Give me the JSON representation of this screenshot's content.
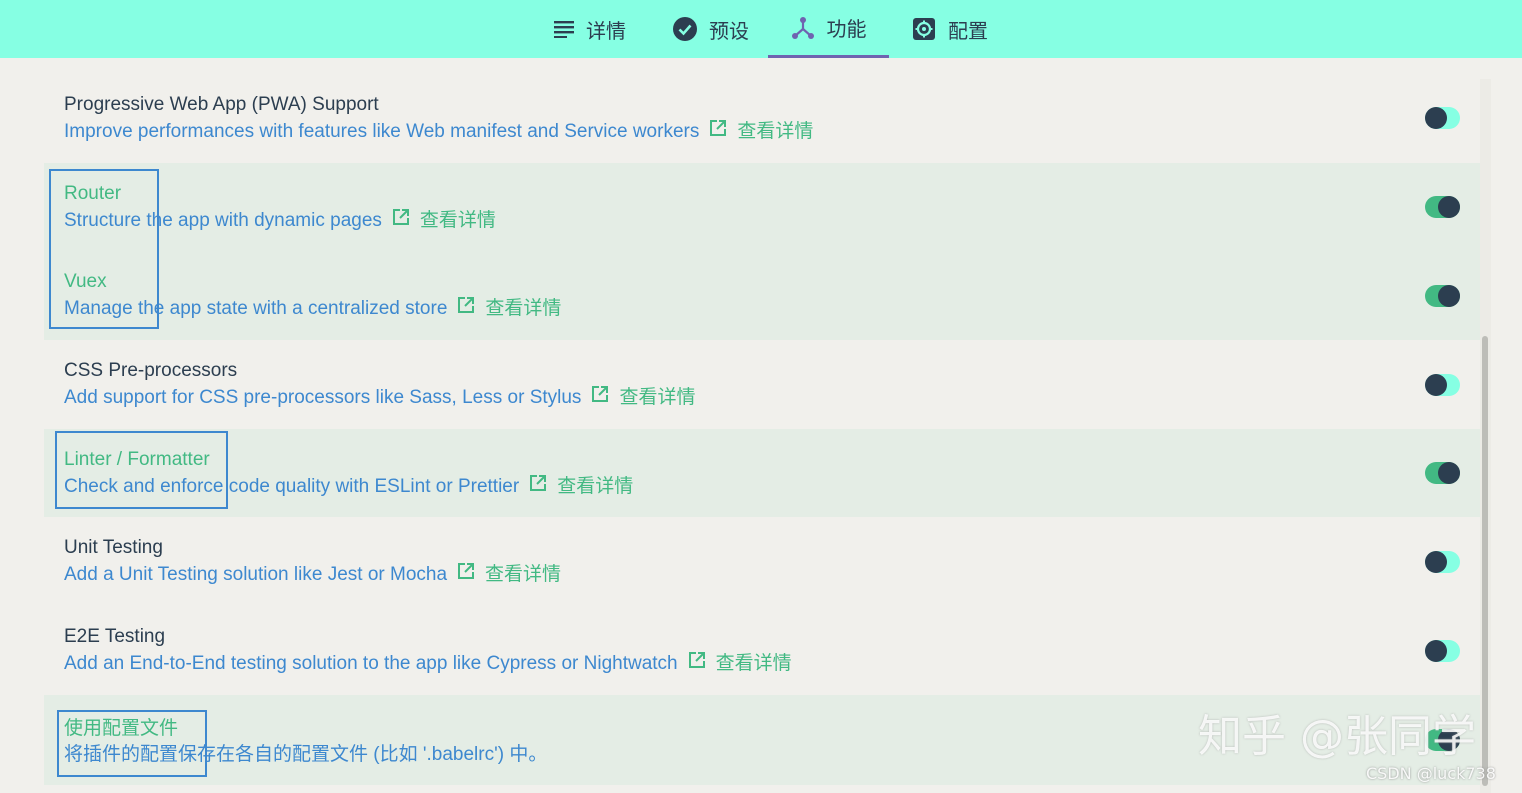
{
  "tabs": [
    {
      "label": "详情",
      "icon": "list-icon"
    },
    {
      "label": "预设",
      "icon": "check-circle-icon"
    },
    {
      "label": "功能",
      "icon": "branch-icon"
    },
    {
      "label": "配置",
      "icon": "gear-icon"
    }
  ],
  "active_tab": "功能",
  "features": [
    {
      "title": "Progressive Web App (PWA) Support",
      "description": "Improve performances with features like Web manifest and Service workers",
      "more": "查看详情",
      "enabled": false
    },
    {
      "title": "Router",
      "description": "Structure the app with dynamic pages",
      "more": "查看详情",
      "enabled": true
    },
    {
      "title": "Vuex",
      "description": "Manage the app state with a centralized store",
      "more": "查看详情",
      "enabled": true
    },
    {
      "title": "CSS Pre-processors",
      "description": "Add support for CSS pre-processors like Sass, Less or Stylus",
      "more": "查看详情",
      "enabled": false
    },
    {
      "title": "Linter / Formatter",
      "description": "Check and enforce code quality with ESLint or Prettier",
      "more": "查看详情",
      "enabled": true
    },
    {
      "title": "Unit Testing",
      "description": "Add a Unit Testing solution like Jest or Mocha",
      "more": "查看详情",
      "enabled": false
    },
    {
      "title": "E2E Testing",
      "description": "Add an End-to-End testing solution to the app like Cypress or Nightwatch",
      "more": "查看详情",
      "enabled": false
    },
    {
      "title": "使用配置文件",
      "description": "将插件的配置保存在各自的配置文件 (比如 '.babelrc') 中。",
      "enabled": true
    }
  ],
  "watermark": "知乎 @张同学",
  "credit": "CSDN @luck738",
  "colors": {
    "topbar": "#86ffe3",
    "accent_green": "#42b983",
    "link_blue": "#3d88cf",
    "dark": "#2c3e50",
    "selected_row": "#e4ede5",
    "tab_underline": "#6f63b0"
  }
}
